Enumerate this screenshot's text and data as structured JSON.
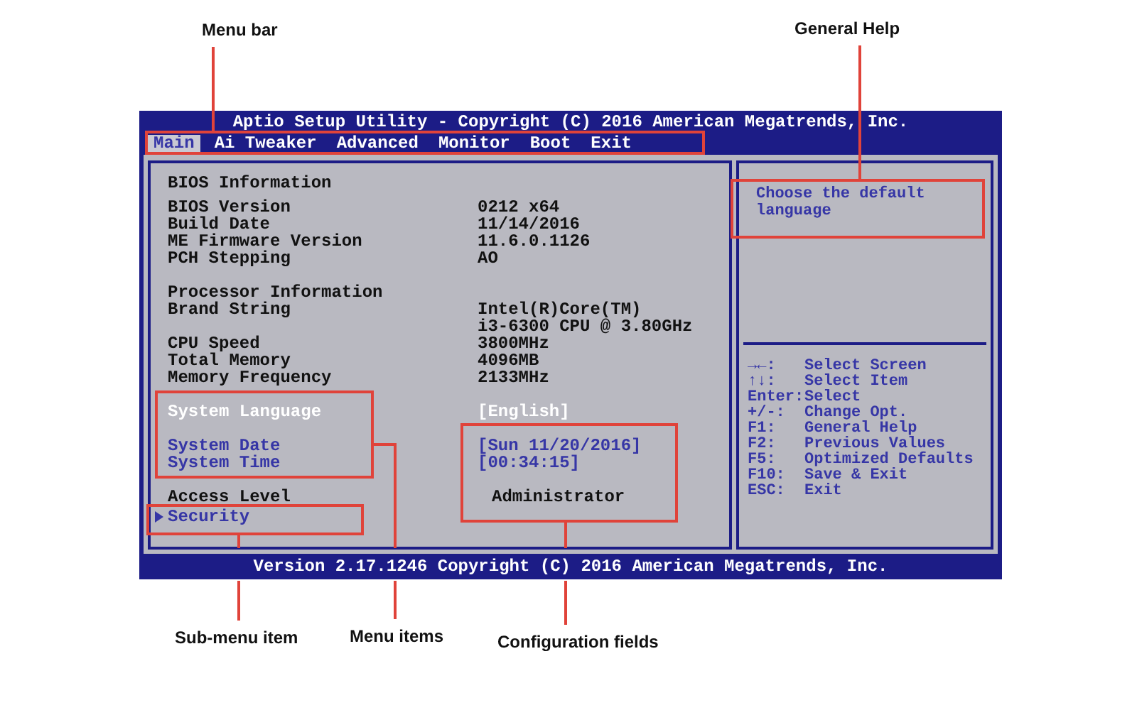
{
  "window": {
    "title": "Aptio Setup Utility - Copyright (C) 2016 American Megatrends, Inc."
  },
  "tabs": [
    {
      "label": "Main",
      "selected": true
    },
    {
      "label": "Ai Tweaker",
      "selected": false
    },
    {
      "label": "Advanced",
      "selected": false
    },
    {
      "label": "Monitor",
      "selected": false
    },
    {
      "label": "Boot",
      "selected": false
    },
    {
      "label": "Exit",
      "selected": false
    }
  ],
  "groups": [
    {
      "rows": [
        {
          "kind": "header",
          "label": "BIOS Information",
          "selected": false
        },
        {
          "kind": "info",
          "label": "BIOS Version",
          "values": [
            "0212 x64"
          ],
          "selected": false
        },
        {
          "kind": "info",
          "label": "Build Date",
          "values": [
            "11/14/2016"
          ],
          "selected": false
        },
        {
          "kind": "info",
          "label": "ME Firmware Version",
          "values": [
            "11.6.0.1126"
          ],
          "selected": false
        },
        {
          "kind": "info",
          "label": "PCH Stepping",
          "values": [
            "AO"
          ],
          "selected": false
        }
      ]
    },
    {
      "rows": [
        {
          "kind": "header",
          "label": "Processor Information",
          "selected": false
        },
        {
          "kind": "info",
          "label": "Brand String",
          "values": [
            "Intel(R)Core(TM)",
            "i3-6300 CPU @ 3.80GHz"
          ],
          "selected": false
        },
        {
          "kind": "info",
          "label": "CPU Speed",
          "values": [
            "3800MHz"
          ],
          "selected": false
        },
        {
          "kind": "info",
          "label": "Total Memory",
          "values": [
            "4096MB"
          ],
          "selected": false
        },
        {
          "kind": "info",
          "label": "Memory Frequency",
          "values": [
            "2133MHz"
          ],
          "selected": false
        }
      ]
    },
    {
      "rows": [
        {
          "kind": "setting",
          "label": "System Language",
          "values": [
            "[English]"
          ],
          "selected": true
        }
      ]
    },
    {
      "rows": [
        {
          "kind": "setting",
          "label": "System Date",
          "values": [
            "[Sun 11/20/2016]"
          ],
          "selected": false
        },
        {
          "kind": "setting",
          "label": "System Time",
          "values": [
            "[00:34:15]"
          ],
          "selected": false
        }
      ]
    },
    {
      "rows": [
        {
          "kind": "info",
          "label": "Access Level",
          "values": [
            "Administrator"
          ],
          "selected": false
        },
        {
          "kind": "submenu",
          "label": "Security",
          "selected": false
        }
      ]
    }
  ],
  "help": {
    "text": "Choose the default language",
    "keys": [
      {
        "key": "→←:",
        "action": "Select Screen"
      },
      {
        "key": "↑↓:",
        "action": "Select Item"
      },
      {
        "key": "Enter:",
        "action": "Select"
      },
      {
        "key": "+/-:",
        "action": "Change Opt."
      },
      {
        "key": "F1:",
        "action": "General Help"
      },
      {
        "key": "F2:",
        "action": "Previous Values"
      },
      {
        "key": "F5:",
        "action": "Optimized Defaults"
      },
      {
        "key": "F10:",
        "action": "Save & Exit"
      },
      {
        "key": "ESC:",
        "action": "Exit"
      }
    ]
  },
  "status_bar": "Version 2.17.1246 Copyright (C) 2016 American Megatrends, Inc.",
  "annotations": [
    "Menu bar",
    "General Help",
    "Sub-menu item",
    "Menu items",
    "Configuration fields"
  ]
}
